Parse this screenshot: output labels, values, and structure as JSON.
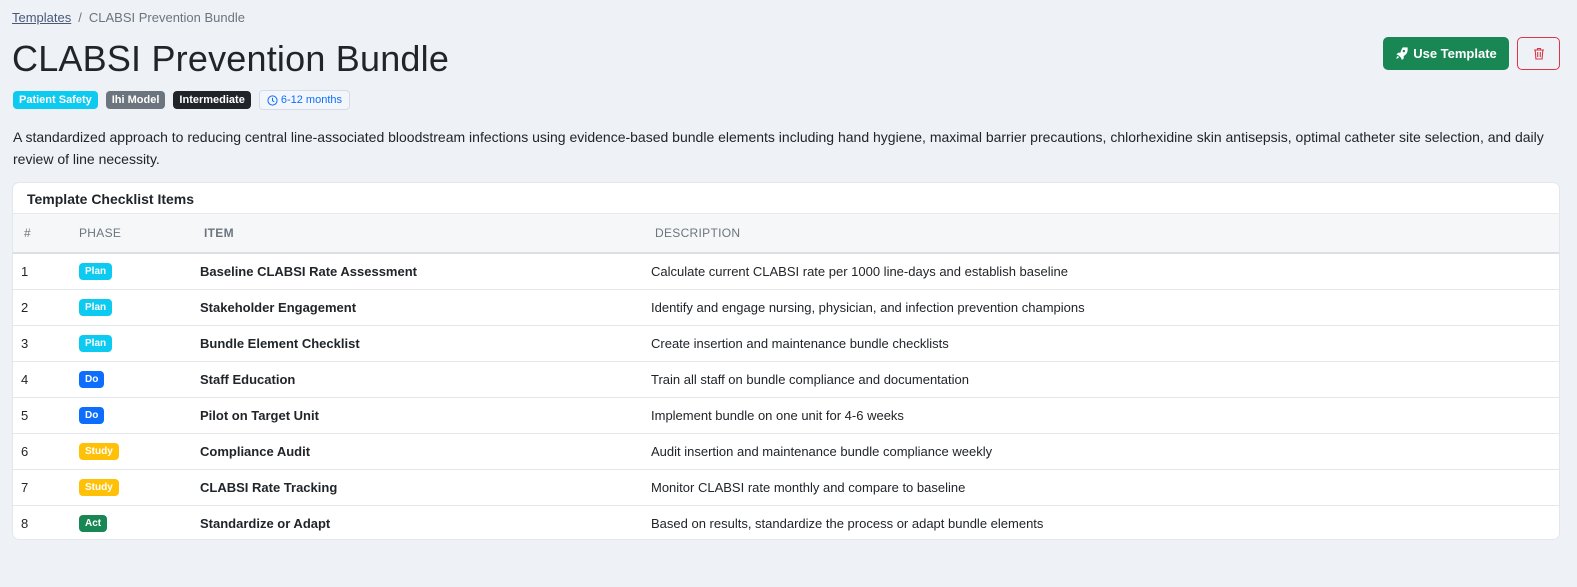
{
  "breadcrumb": {
    "parent": "Templates",
    "separator": "/",
    "current": "CLABSI Prevention Bundle"
  },
  "page": {
    "title": "CLABSI Prevention Bundle",
    "badges": {
      "category": "Patient Safety",
      "model": "Ihi Model",
      "level": "Intermediate",
      "duration": "6-12 months"
    },
    "description": "A standardized approach to reducing central line-associated bloodstream infections using evidence-based bundle elements including hand hygiene, maximal barrier precautions, chlorhexidine skin antisepsis, optimal catheter site selection, and daily review of line necessity."
  },
  "actions": {
    "use_template_label": "Use Template",
    "delete_icon": "trash-icon"
  },
  "checklist": {
    "title": "Template Checklist Items",
    "columns": {
      "num": "#",
      "phase": "Phase",
      "item": "Item",
      "description": "Description"
    },
    "rows": [
      {
        "num": "1",
        "phase": "Plan",
        "item": "Baseline CLABSI Rate Assessment",
        "description": "Calculate current CLABSI rate per 1000 line-days and establish baseline"
      },
      {
        "num": "2",
        "phase": "Plan",
        "item": "Stakeholder Engagement",
        "description": "Identify and engage nursing, physician, and infection prevention champions"
      },
      {
        "num": "3",
        "phase": "Plan",
        "item": "Bundle Element Checklist",
        "description": "Create insertion and maintenance bundle checklists"
      },
      {
        "num": "4",
        "phase": "Do",
        "item": "Staff Education",
        "description": "Train all staff on bundle compliance and documentation"
      },
      {
        "num": "5",
        "phase": "Do",
        "item": "Pilot on Target Unit",
        "description": "Implement bundle on one unit for 4-6 weeks"
      },
      {
        "num": "6",
        "phase": "Study",
        "item": "Compliance Audit",
        "description": "Audit insertion and maintenance bundle compliance weekly"
      },
      {
        "num": "7",
        "phase": "Study",
        "item": "CLABSI Rate Tracking",
        "description": "Monitor CLABSI rate monthly and compare to baseline"
      },
      {
        "num": "8",
        "phase": "Act",
        "item": "Standardize or Adapt",
        "description": "Based on results, standardize the process or adapt bundle elements"
      }
    ]
  },
  "colors": {
    "Plan": "#0dcaf0",
    "Do": "#0d6efd",
    "Study": "#ffc107",
    "Act": "#198754"
  }
}
